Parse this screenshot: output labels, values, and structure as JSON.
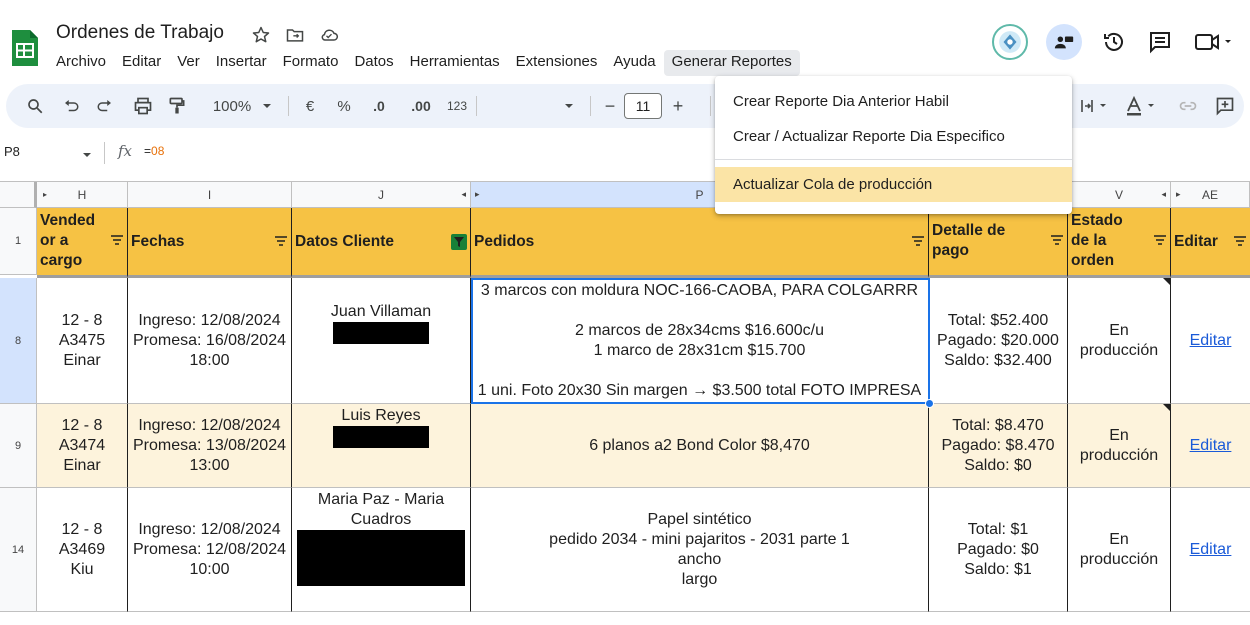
{
  "app": {
    "doc_title": "Ordenes de Trabajo",
    "menus": [
      "Archivo",
      "Editar",
      "Ver",
      "Insertar",
      "Formato",
      "Datos",
      "Herramientas",
      "Extensiones",
      "Ayuda",
      "Generar Reportes"
    ],
    "active_menu": "Generar Reportes",
    "brand_color": "#1e8e3e"
  },
  "toolbar": {
    "zoom": "100%",
    "currency": "€",
    "percent": "%",
    "dec_less": ".0",
    "dec_more": ".00",
    "number_format": "123",
    "font_size": "11",
    "minus": "−",
    "plus": "+"
  },
  "formula_bar": {
    "cell_ref": "P8",
    "eq": "=",
    "value": "08"
  },
  "dropdown": {
    "items": [
      "Crear Reporte Dia Anterior Habil",
      "Crear / Actualizar Reporte Dia Especifico",
      "Actualizar Cola de producción"
    ],
    "highlighted_index": 2
  },
  "columns": {
    "H": "H",
    "I": "I",
    "J": "J",
    "P": "P",
    "V": "V",
    "AE": "AE"
  },
  "header_row": {
    "row_num": "1",
    "vendedor": [
      "Vended",
      "or a",
      "cargo"
    ],
    "fechas": "Fechas",
    "datos_cliente": "Datos Cliente",
    "pedidos": "Pedidos",
    "detalle_pago": [
      "Detalle de",
      "pago"
    ],
    "estado": [
      "Estado",
      "de la",
      "orden"
    ],
    "editar": "Editar"
  },
  "rows": [
    {
      "row_num": "8",
      "vendedor": [
        "12 - 8",
        "A3475",
        "Einar"
      ],
      "fechas": [
        "Ingreso: 12/08/2024",
        "Promesa: 16/08/2024",
        "18:00"
      ],
      "cliente": [
        "Juan Villaman"
      ],
      "pedidos": [
        "3 marcos con moldura NOC-166-CAOBA, PARA COLGARRR",
        "",
        "2 marcos de 28x34cms $16.600c/u",
        "1 marco de 28x31cm  $15.700",
        "",
        "1 uni. Foto 20x30 Sin margen → $3.500 total FOTO IMPRESA"
      ],
      "pago": [
        "Total: $52.400",
        "Pagado: $20.000",
        "Saldo: $32.400"
      ],
      "estado": [
        "En",
        "producción"
      ],
      "editar": "Editar"
    },
    {
      "row_num": "9",
      "vendedor": [
        "12 - 8",
        "A3474",
        "Einar"
      ],
      "fechas": [
        "Ingreso: 12/08/2024",
        "Promesa: 13/08/2024",
        "13:00"
      ],
      "cliente": [
        "Luis Reyes"
      ],
      "pedidos": [
        "6 planos a2 Bond Color $8,470"
      ],
      "pago": [
        "Total: $8.470",
        "Pagado: $8.470",
        "Saldo: $0"
      ],
      "estado": [
        "En",
        "producción"
      ],
      "editar": "Editar"
    },
    {
      "row_num": "14",
      "vendedor": [
        "12 - 8",
        "A3469",
        "Kiu"
      ],
      "fechas": [
        "Ingreso: 12/08/2024",
        "Promesa: 12/08/2024",
        "10:00"
      ],
      "cliente": [
        "Maria Paz - Maria",
        "Cuadros"
      ],
      "pedidos": [
        "Papel sintético",
        "pedido 2034 - mini pajaritos - 2031 parte 1",
        "ancho",
        "largo"
      ],
      "pago": [
        "Total: $1",
        "Pagado: $0",
        "Saldo: $1"
      ],
      "estado": [
        "En",
        "producción"
      ],
      "editar": "Editar"
    }
  ],
  "colors": {
    "header_fill": "#f6c244",
    "band_fill": "#fdf3dc",
    "link": "#1a5ad8",
    "selection": "#1a73e8"
  }
}
